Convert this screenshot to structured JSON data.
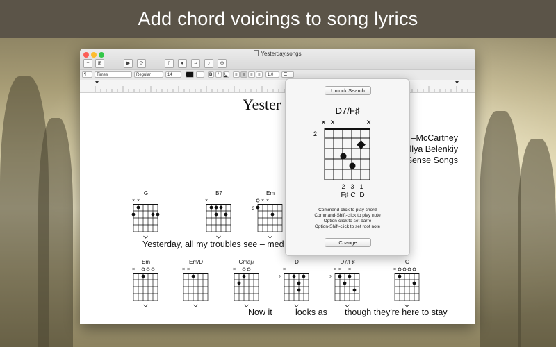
{
  "banner": {
    "text": "Add chord voicings to song lyrics"
  },
  "window": {
    "title": "Yesterday.songs",
    "traffic_colors": [
      "#fc5f57",
      "#fdbc2e",
      "#33c748"
    ],
    "toolbar_icons": [
      "add-icon",
      "cart-icon",
      "play-icon",
      "loop-icon",
      "document-icon",
      "record-icon",
      "fit-icon",
      "guitar-icon",
      "zoom-icon"
    ]
  },
  "format": {
    "style_value": "¶",
    "font_value": "Times",
    "weight_value": "Regular",
    "size_value": "14",
    "bold": "B",
    "italic": "I",
    "underline": "U",
    "spacing_value": "1.0"
  },
  "song": {
    "title": "Yester",
    "credits": [
      "–McCartney",
      "Illya Belenkiy",
      "Sense Songs"
    ],
    "line1": "Yesterday, all my troubles see – med",
    "line2": [
      "Now it",
      "looks as",
      "though they're here to stay"
    ]
  },
  "chords_row1": [
    {
      "name": "G",
      "marks": "xx",
      "fret": ""
    },
    {
      "name": "B7",
      "marks": "x",
      "fret": ""
    },
    {
      "name": "Em",
      "marks": "oxx",
      "fret": "3"
    }
  ],
  "chords_row2": [
    {
      "name": "Em",
      "marks": "x ooo",
      "fret": ""
    },
    {
      "name": "Em/D",
      "marks": "xx",
      "fret": ""
    },
    {
      "name": "Cmaj7",
      "marks": "x oo",
      "fret": ""
    },
    {
      "name": "D",
      "marks": "x",
      "fret": "2"
    },
    {
      "name": "D7/F♯",
      "marks": "xx x",
      "fret": "2"
    },
    {
      "name": "G",
      "marks": "xoooo",
      "fret": ""
    }
  ],
  "popover": {
    "unlock_label": "Unlock Search",
    "chord_name": "D7/F♯",
    "fret": "2",
    "string_marks": [
      "×",
      "×",
      "×"
    ],
    "fingers": [
      "2",
      "3",
      "1"
    ],
    "notes": [
      "F♯",
      "C",
      "D"
    ],
    "hints": [
      "Command-click to play chord",
      "Command-Shift-click to play note",
      "Option-click to set barre",
      "Option-Shift-click to set root note"
    ],
    "change_label": "Change"
  }
}
